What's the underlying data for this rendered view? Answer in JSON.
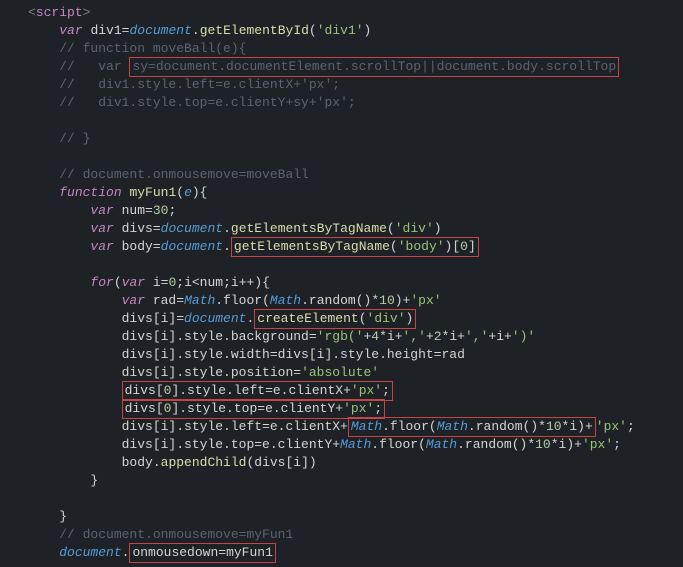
{
  "code": {
    "l1_open": "<",
    "l1_tag": "script",
    "l1_close": ">",
    "l2_var": "var",
    "l2_div1": "div1",
    "l2_eq": "=",
    "l2_doc": "document",
    "l2_dot": ".",
    "l2_method": "getElementById",
    "l2_p1": "(",
    "l2_str": "'div1'",
    "l2_p2": ")",
    "l3": "// function moveBall(e){",
    "l4a": "//   var ",
    "l4b": "sy=document.documentElement.scrollTop||document.body.scrollTop",
    "l5": "//   div1.style.left=e.clientX+'px';",
    "l6": "//   div1.style.top=e.clientY+sy+'px';",
    "l7": "// }",
    "l8": "// document.onmousemove=moveBall",
    "l9_func": "function",
    "l9_name": " myFun1",
    "l9_p": "(",
    "l9_e": "e",
    "l9_p2": "){",
    "l10_var": "var",
    "l10_name": " num",
    "l10_eq": "=",
    "l10_num": "30",
    "l10_semi": ";",
    "l11_var": "var",
    "l11_name": " divs",
    "l11_eq": "=",
    "l11_doc": "document",
    "l11_dot": ".",
    "l11_method": "getElementsByTagName",
    "l11_p": "(",
    "l11_str": "'div'",
    "l11_p2": ")",
    "l12_var": "var",
    "l12_name": " body",
    "l12_eq": "=",
    "l12_doc": "document",
    "l12_dot": ".",
    "l12_method": "getElementsByTagName",
    "l12_p": "(",
    "l12_str": "'body'",
    "l12_p2": ")[",
    "l12_idx": "0",
    "l12_p3": "]",
    "l13_for": "for",
    "l13_p": "(",
    "l13_var": "var",
    "l13_i": " i",
    "l13_eq": "=",
    "l13_z": "0",
    "l13_cond": ";i<num;i",
    "l13_inc": "++",
    "l13_p2": "){",
    "l14_var": "var",
    "l14_rad": " rad",
    "l14_eq": "=",
    "l14_math": "Math",
    "l14_floor": ".floor(",
    "l14_math2": "Math",
    "l14_rand": ".random()",
    "l14_mul": "*",
    "l14_10": "10",
    "l14_p": ")+",
    "l14_px": "'px'",
    "l15_divs": "divs[i]",
    "l15_eq": "=",
    "l15_doc": "document",
    "l15_dot": ".",
    "l15_method": "createElement",
    "l15_p": "(",
    "l15_str": "'div'",
    "l15_p2": ")",
    "l16a": "divs[i].style.background=",
    "l16b": "'rgb('",
    "l16c": "+",
    "l16d": "4",
    "l16e": "*",
    "l16f": "i+",
    "l16g": "','",
    "l16h": "+",
    "l16i": "2",
    "l16j": "*",
    "l16k": "i+",
    "l16l": "','",
    "l16m": "+i+",
    "l16n": "')'",
    "l17": "divs[i].style.width=divs[i].style.height=rad",
    "l18a": "divs[i].style.position=",
    "l18b": "'absolute'",
    "l19a": "divs[",
    "l19b": "0",
    "l19c": "].style.left=e.clientX+",
    "l19d": "'px'",
    "l19e": ";",
    "l20a": "divs[",
    "l20b": "0",
    "l20c": "].style.top=e.clientY+",
    "l20d": "'px'",
    "l20e": ";",
    "l21a": "divs[i].style.left=e.clientX+",
    "l21b": "Math",
    "l21c": ".floor(",
    "l21d": "Math",
    "l21e": ".random()*",
    "l21f": "10",
    "l21g": "*i)+",
    "l21h": "'px'",
    "l21i": ";",
    "l22a": "divs[i].style.top=e.clientY+",
    "l22b": "Math",
    "l22c": ".floor(",
    "l22d": "Math",
    "l22e": ".random()*",
    "l22f": "10",
    "l22g": "*i)+",
    "l22h": "'px'",
    "l22i": ";",
    "l23a": "body.",
    "l23b": "appendChild",
    "l23c": "(divs[i])",
    "l24": "}",
    "l25": "}",
    "l26": "// document.onmousemove=myFun1",
    "l27_doc": "document",
    "l27_dot": ".",
    "l27_rest": "onmousedown=myFun1"
  }
}
